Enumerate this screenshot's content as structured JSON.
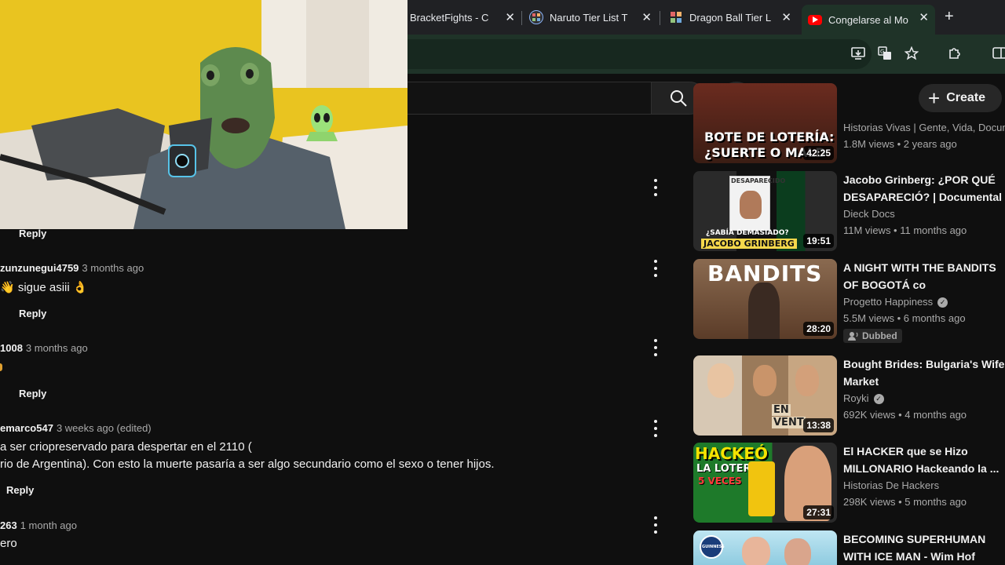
{
  "browser": {
    "tabs": [
      {
        "label": "BracketFights - C",
        "favicon": "bracketfights-favicon"
      },
      {
        "label": "Naruto Tier List T",
        "favicon": "tiermaker-favicon"
      },
      {
        "label": "Dragon Ball Tier L",
        "favicon": "tiermaker-favicon"
      },
      {
        "label": "Congelarse al Mo",
        "favicon": "youtube-favicon",
        "active": true
      }
    ],
    "close_glyph": "✕",
    "new_tab_glyph": "+"
  },
  "header": {
    "search_placeholder": "",
    "create_label": "Create",
    "create_glyph": "+"
  },
  "comments": [
    {
      "author": "",
      "time": "",
      "text": "",
      "reply": "Reply"
    },
    {
      "author": "zunzunegui4759",
      "time": "3 months ago",
      "text": "👋 sigue asiii 👌",
      "reply": "Reply"
    },
    {
      "author": "1008",
      "time": "3 months ago",
      "text": "",
      "reply": "Reply"
    },
    {
      "author": "emarco547",
      "time": "3 weeks ago (edited)",
      "text_lines": [
        "a ser criopreservado para despertar en el 2110 (",
        "rio de Argentina). Con esto la muerte pasaría a ser algo secundario como el sexo o tener hijos."
      ],
      "reply": "Reply"
    },
    {
      "author": "263",
      "time": "1 month ago",
      "text": "ero",
      "reply": ""
    }
  ],
  "recommendations": [
    {
      "title_lines": [
        "Historias Vivas | Gente, Vida, Docum"
      ],
      "title_is_channel": true,
      "meta": "1.8M views • 2 years ago",
      "duration": "42:25",
      "thumb_text": [
        "BOTE DE LOTERÍA:",
        "¿SUERTE O MALD"
      ]
    },
    {
      "title_lines": [
        "Jacobo Grinberg: ¿POR QUÉ",
        "DESAPARECIÓ? | Documental"
      ],
      "channel": "Dieck Docs",
      "verified": false,
      "meta": "11M views • 11 months ago",
      "duration": "19:51",
      "thumb_text": [
        "DESAPARECIDO",
        "¿SABÍA DEMASIADO?",
        "JACOBO GRINBERG"
      ]
    },
    {
      "title_lines": [
        "A NIGHT WITH THE BANDITS",
        "OF BOGOTÁ co"
      ],
      "channel": "Progetto Happiness",
      "verified": true,
      "meta": "5.5M views • 6 months ago",
      "badge": "Dubbed",
      "duration": "28:20",
      "thumb_text": [
        "BANDITS"
      ]
    },
    {
      "title_lines": [
        "Bought Brides: Bulgaria's Wife",
        "Market"
      ],
      "channel": "Royki",
      "verified": true,
      "meta": "692K views • 4 months ago",
      "duration": "13:38",
      "thumb_text": [
        "EN",
        "VENT"
      ]
    },
    {
      "title_lines": [
        "El HACKER que se Hizo",
        "MILLONARIO Hackeando la ..."
      ],
      "channel": "Historias De Hackers",
      "verified": false,
      "meta": "298K views • 5 months ago",
      "duration": "27:31",
      "thumb_text": [
        "HACKEÓ",
        "LA LOTERIA",
        "5 VECES"
      ]
    },
    {
      "title_lines": [
        "BECOMING SUPERHUMAN",
        "WITH ICE MAN - Wim Hof"
      ],
      "channel": "",
      "meta": "",
      "duration": "",
      "thumb_text": [
        "GUINNESS"
      ]
    }
  ],
  "colors": {
    "youtube_bg": "#0f0f0f",
    "chrome_tab_bar": "#202124",
    "chrome_toolbar": "#1f3328",
    "webcam_wall": "#e9c420",
    "mask_green": "#5d8a4e"
  }
}
